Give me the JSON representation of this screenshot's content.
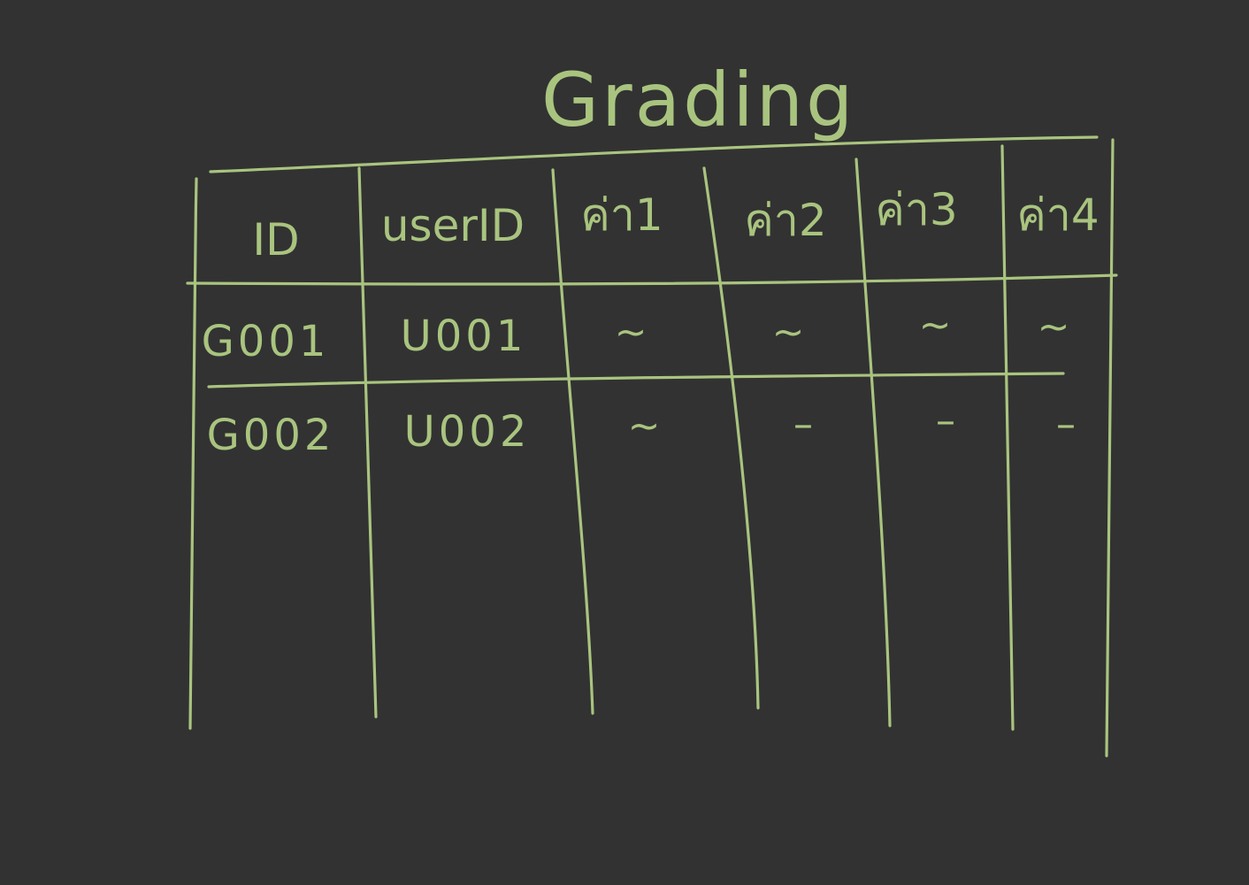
{
  "table": {
    "title": "Grading",
    "headers": [
      "ID",
      "userID",
      "ค่า1",
      "ค่า2",
      "ค่า3",
      "ค่า4"
    ],
    "rows": [
      [
        "G001",
        "U001",
        "~",
        "~",
        "~",
        "~"
      ],
      [
        "G002",
        "U002",
        "~",
        "–",
        "–",
        "–"
      ]
    ]
  },
  "colors": {
    "background": "#323232",
    "ink": "#a9c47f"
  }
}
